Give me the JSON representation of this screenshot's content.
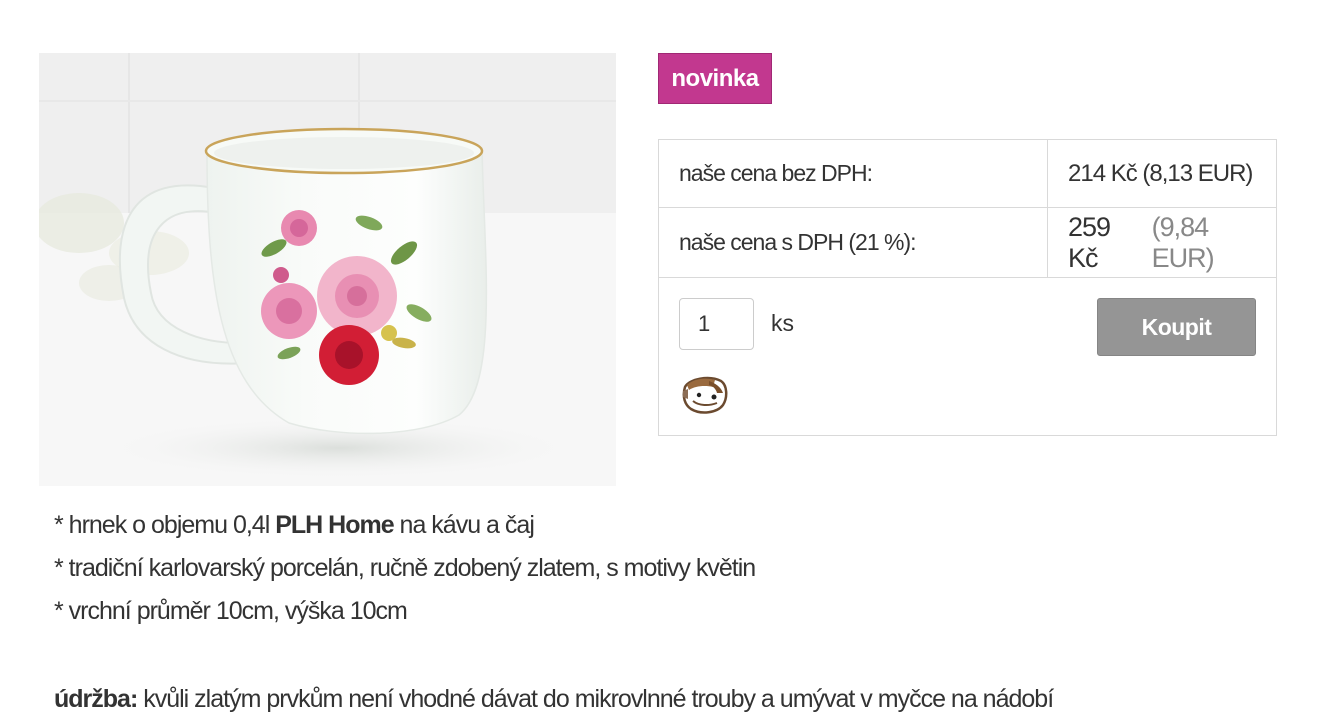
{
  "product": {
    "badge": "novinka",
    "image_alt": "porcelain mug with roses"
  },
  "prices": {
    "without_vat_label": "naše cena bez DPH:",
    "without_vat_value": "214 Kč (8,13 EUR)",
    "with_vat_label": "naše cena s DPH (21 %):",
    "with_vat_czk": "259 Kč",
    "with_vat_eur": "(9,84 EUR)"
  },
  "purchase": {
    "quantity": "1",
    "unit": "ks",
    "buy_label": "Koupit"
  },
  "description": {
    "line1_pre": "* hrnek o objemu 0,4l ",
    "line1_brand": "PLH Home",
    "line1_post": " na kávu a čaj",
    "line2": "* tradiční karlovarský porcelán, ručně zdobený zlatem, s motivy květin",
    "line3": "* vrchní průměr 10cm, výška 10cm",
    "maintenance_label": "údržba:",
    "maintenance_text": " kvůli zlatým prvkům není vhodné dávat do mikrovlnné trouby a umývat v myčce na nádobí"
  },
  "colors": {
    "badge": "#c2388f",
    "buy_button": "#959595",
    "border": "#d9d9d9",
    "muted": "#888888"
  }
}
